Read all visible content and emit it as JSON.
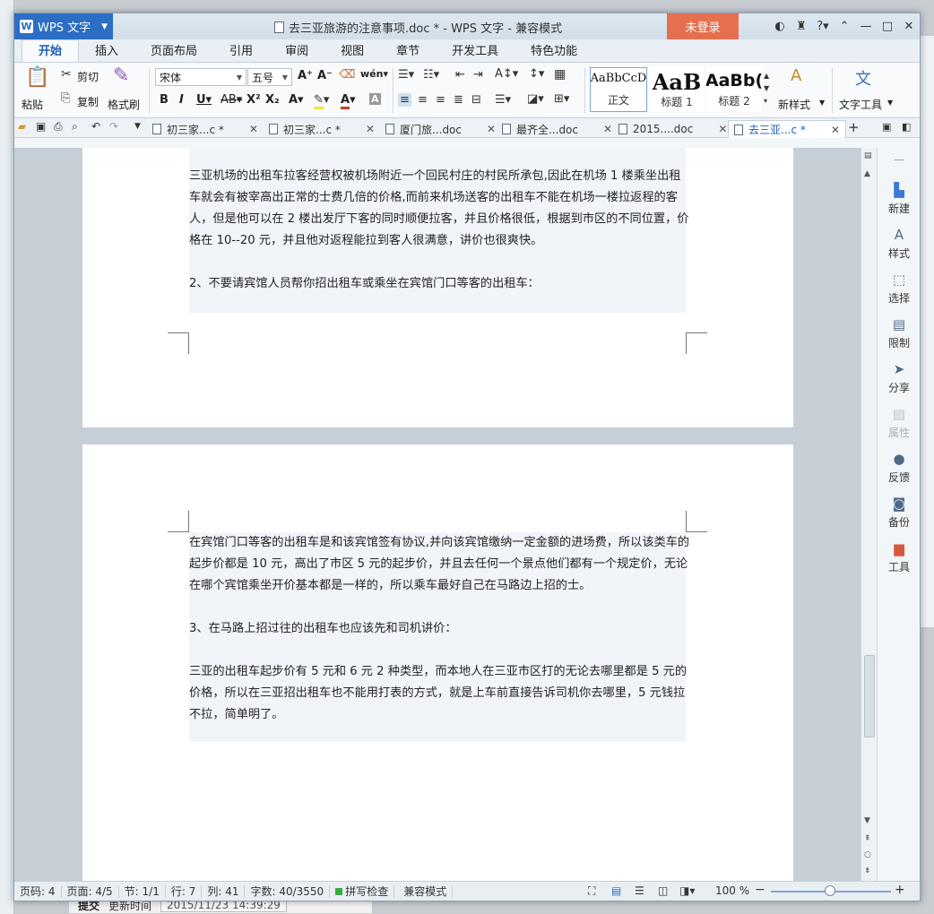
{
  "app": {
    "name": "WPS 文字",
    "title": "去三亚旅游的注意事项.doc * - WPS 文字 - 兼容模式",
    "login": "未登录"
  },
  "menu": {
    "tabs": [
      "开始",
      "插入",
      "页面布局",
      "引用",
      "审阅",
      "视图",
      "章节",
      "开发工具",
      "特色功能"
    ]
  },
  "ribbon": {
    "paste": "粘贴",
    "cut": "剪切",
    "copy": "复制",
    "format_painter": "格式刷",
    "font_name": "宋体",
    "font_size": "五号",
    "styles": [
      {
        "sample": "AaBbCcD",
        "label": "正文"
      },
      {
        "sample": "AaB",
        "label": "标题 1"
      },
      {
        "sample": "AaBb(",
        "label": "标题 2"
      }
    ],
    "new_style": "新样式",
    "text_tools": "文字工具"
  },
  "doc_tabs": [
    {
      "label": "初三家...c *",
      "active": false
    },
    {
      "label": "初三家...c *",
      "active": false
    },
    {
      "label": "厦门旅...doc",
      "active": false
    },
    {
      "label": "最齐全...doc",
      "active": false
    },
    {
      "label": "2015....doc",
      "active": false
    },
    {
      "label": "去三亚...c *",
      "active": true
    }
  ],
  "document": {
    "page1": [
      "三亚机场的出租车拉客经营权被机场附近一个回民村庄的村民所承包,因此在机场 1 楼乘坐出租车就会有被宰高出正常的士费几倍的价格,而前来机场送客的出租车不能在机场一楼拉返程的客人，但是他可以在 2 楼出发厅下客的同时顺便拉客，并且价格很低，根据到市区的不同位置，价格在 10--20 元，并且他对返程能拉到客人很满意，讲价也很爽快。",
      "2、不要请宾馆人员帮你招出租车或乘坐在宾馆门口等客的出租车："
    ],
    "page2": [
      "在宾馆门口等客的出租车是和该宾馆签有协议,并向该宾馆缴纳一定金额的进场费，所以该类车的起步价都是 10 元，高出了市区 5 元的起步价，并且去任何一个景点他们都有一个规定价，无论在哪个宾馆乘坐开价基本都是一样的，所以乘车最好自己在马路边上招的士。",
      "3、在马路上招过往的出租车也应该先和司机讲价：",
      "三亚的出租车起步价有 5 元和 6 元 2 种类型，而本地人在三亚市区打的无论去哪里都是 5 元的价格，所以在三亚招出租车也不能用打表的方式，就是上车前直接告诉司机你去哪里，5 元钱拉不拉，简单明了。"
    ]
  },
  "side_panel": [
    "新建",
    "样式",
    "选择",
    "限制",
    "分享",
    "属性",
    "反馈",
    "备份",
    "工具"
  ],
  "status": {
    "page_num": "页码: 4",
    "pages": "页面: 4/5",
    "section": "节: 1/1",
    "row": "行: 7",
    "col": "列: 41",
    "words": "字数: 40/3550",
    "spell": "拼写检查",
    "compat": "兼容模式",
    "zoom": "100 %"
  },
  "background": {
    "submit": "提交",
    "update_label": "更新时间",
    "update_time": "2015/11/23 14:39:29"
  },
  "colors": {
    "accent": "#2b6ec4",
    "login_bg": "#e4704f"
  }
}
